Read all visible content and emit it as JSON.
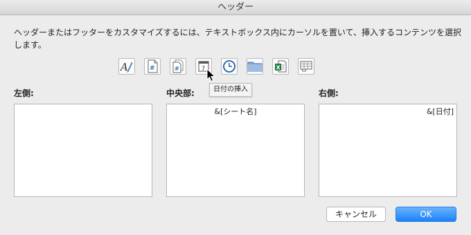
{
  "window": {
    "title": "ヘッダー"
  },
  "instructions": "ヘッダーまたはフッターをカスタマイズするには、テキストボックス内にカーソルを置いて、挿入するコンテンツを選択します。",
  "toolbar": {
    "buttons": [
      {
        "icon": "format-text-icon"
      },
      {
        "icon": "page-number-icon"
      },
      {
        "icon": "number-of-pages-icon"
      },
      {
        "icon": "calendar-icon"
      },
      {
        "icon": "clock-icon"
      },
      {
        "icon": "folder-icon"
      },
      {
        "icon": "excel-file-icon"
      },
      {
        "icon": "sheet-tab-icon"
      }
    ],
    "tooltip": "日付の挿入"
  },
  "sections": {
    "left": {
      "label": "左側:",
      "value": ""
    },
    "center": {
      "label": "中央部:",
      "value": "&[シート名]"
    },
    "right": {
      "label": "右側:",
      "value": "&[日付]"
    }
  },
  "buttons": {
    "cancel": "キャンセル",
    "ok": "OK"
  },
  "colors": {
    "accent": "#1a82fb",
    "background": "#ececec"
  }
}
